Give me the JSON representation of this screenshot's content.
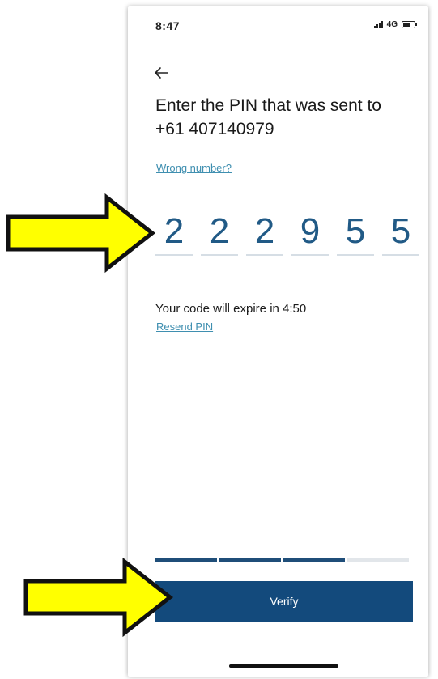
{
  "status_bar": {
    "time": "8:47",
    "network": "4G"
  },
  "screen": {
    "title": "Enter the PIN that was sent to +61 407140979",
    "wrong_number_link": "Wrong number?",
    "pin_digits": [
      "2",
      "2",
      "2",
      "9",
      "5",
      "5"
    ],
    "expire_text": "Your code will expire in 4:50",
    "resend_link": "Resend PIN",
    "progress": {
      "steps_total": 4,
      "steps_completed": 3
    },
    "verify_button": "Verify"
  },
  "annotations": {
    "arrow_color": "#ffff00"
  },
  "colors": {
    "primary": "#134a7c",
    "pin_text": "#215a86",
    "link": "#3f8fb0"
  },
  "icons": {
    "back": "arrow-left-icon",
    "signal": "signal-icon",
    "battery": "battery-icon"
  }
}
